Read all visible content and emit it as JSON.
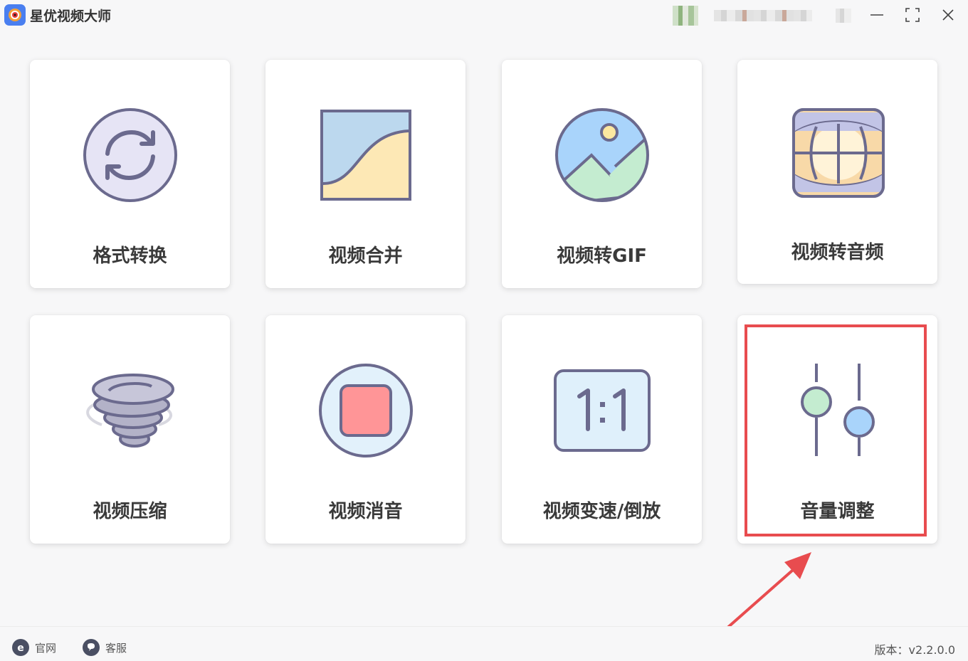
{
  "app": {
    "title": "星优视频大师"
  },
  "cards": [
    {
      "label": "格式转换",
      "icon": "convert-icon"
    },
    {
      "label": "视频合并",
      "icon": "merge-icon"
    },
    {
      "label": "视频转GIF",
      "icon": "gif-image-icon"
    },
    {
      "label": "视频转音频",
      "icon": "audio-globe-icon"
    },
    {
      "label": "视频压缩",
      "icon": "tornado-compress-icon"
    },
    {
      "label": "视频消音",
      "icon": "stop-mute-icon"
    },
    {
      "label": "视频变速/倒放",
      "icon": "ratio-speed-icon"
    },
    {
      "label": "音量调整",
      "icon": "volume-sliders-icon"
    }
  ],
  "footer": {
    "website": "官网",
    "support": "客服",
    "version": "版本：v2.2.0.0"
  },
  "colors": {
    "highlight": "#e84c4f",
    "icon_stroke": "#6b6a8e",
    "background": "#f7f7f8"
  }
}
